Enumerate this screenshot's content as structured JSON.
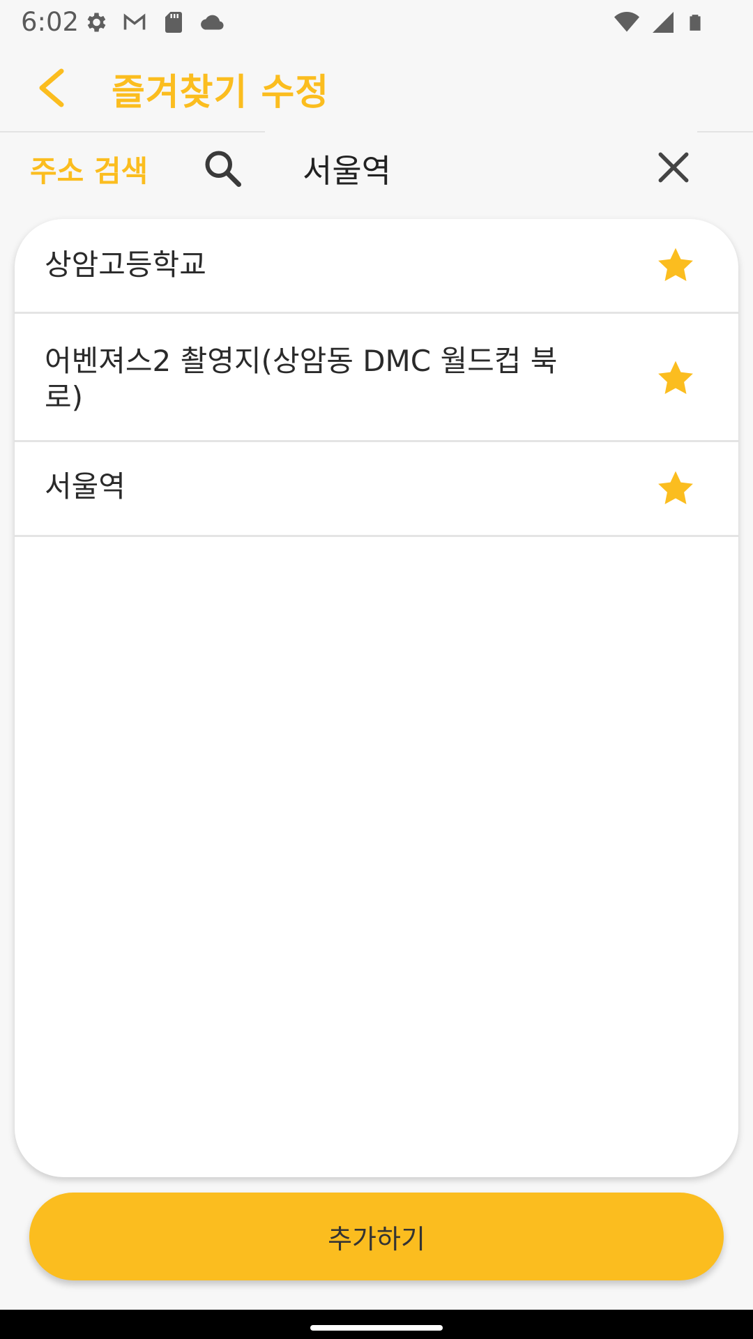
{
  "status_bar": {
    "time": "6:02",
    "left_icons": [
      "settings-icon",
      "gmail-icon",
      "sd-card-icon",
      "cloud-icon"
    ],
    "right_icons": [
      "wifi-icon",
      "cell-signal-icon",
      "battery-icon"
    ]
  },
  "app_bar": {
    "title": "즐겨찾기 수정",
    "back_icon": "chevron-left-icon"
  },
  "search": {
    "label": "주소 검색",
    "value": "서울역",
    "search_icon": "search-icon",
    "clear_icon": "close-icon"
  },
  "favorites": [
    {
      "label": "상암고등학교",
      "starred": true
    },
    {
      "label": "어벤져스2 촬영지(상암동 DMC 월드컵 북로)",
      "starred": true
    },
    {
      "label": "서울역",
      "starred": true
    }
  ],
  "add_button": {
    "label": "추가하기"
  },
  "colors": {
    "accent": "#fbbd1f",
    "background": "#f7f7f7",
    "card": "#ffffff",
    "text": "#2a2a2a"
  }
}
